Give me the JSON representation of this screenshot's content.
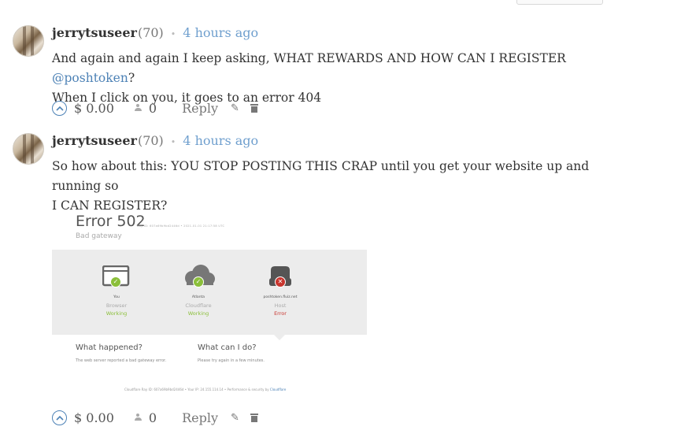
{
  "comments": [
    {
      "author": "jerrytsuseer",
      "reputation": "(70)",
      "separator": "•",
      "time": "4 hours ago",
      "body_line1_prefix": "And again and again I keep asking, WHAT REWARDS AND HOW CAN I REGISTER ",
      "mention": "@poshtoken",
      "body_line1_suffix": "?",
      "body_line2": "When I click on you, it goes to an error 404",
      "payout": "$ 0.00",
      "voters": "0",
      "reply_label": "Reply"
    },
    {
      "author": "jerrytsuseer",
      "reputation": "(70)",
      "separator": "•",
      "time": "4 hours ago",
      "body_line1": "So how about this: YOU STOP POSTING THIS CRAP until you get your website up and running so",
      "body_line2": "I CAN REGISTER?",
      "payout": "$ 0.00",
      "voters": "0",
      "reply_label": "Reply",
      "embed": {
        "title": "Error 502",
        "ray_id": "Ray ID: 607a69b9bd2446d • 2021-01-01 21:17:58 UTC",
        "subtitle": "Bad gateway",
        "nodes": [
          {
            "name": "You",
            "type": "Browser",
            "status": "Working",
            "state": "ok"
          },
          {
            "name": "Atlanta",
            "type": "Cloudflare",
            "status": "Working",
            "state": "ok"
          },
          {
            "name": "poshtoken.fluiz.net",
            "type": "Host",
            "status": "Error",
            "state": "error"
          }
        ],
        "what_happened_heading": "What happened?",
        "what_happened_text": "The web server reported a bad gateway error.",
        "what_can_i_do_heading": "What can I do?",
        "what_can_i_do_text": "Please try again in a few minutes.",
        "footer_prefix": "Cloudflare Ray ID: 607a69b9bd2446d • Your IP: 24.155.114.14 • Performance & security by ",
        "footer_link": "Cloudflare"
      }
    }
  ],
  "colors": {
    "link": "#6f9fce",
    "mention": "#4d82b6",
    "ok": "#8bbf3a",
    "error": "#c8352e"
  },
  "icons": {
    "vote": "chevron-up-circle-icon",
    "voters": "users-icon",
    "edit": "pencil-icon",
    "delete": "trash-icon"
  }
}
